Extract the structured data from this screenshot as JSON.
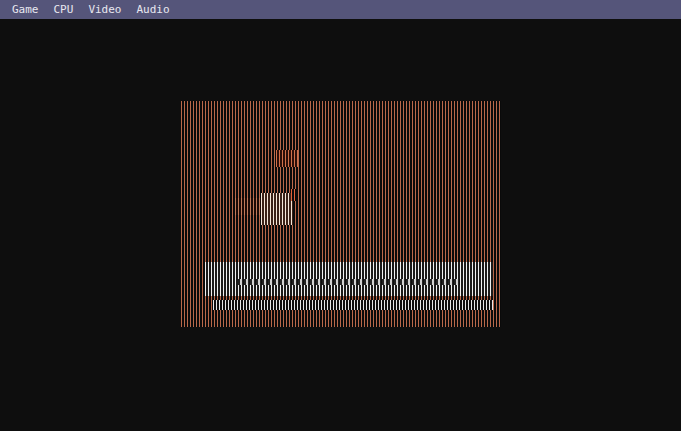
{
  "window": {
    "kind": "emulator"
  },
  "menu": [
    {
      "label": "Game"
    },
    {
      "label": "CPU"
    },
    {
      "label": "Video"
    },
    {
      "label": "Audio"
    }
  ]
}
